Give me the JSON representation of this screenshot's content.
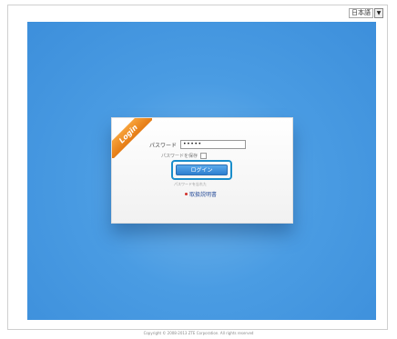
{
  "language": {
    "selected": "日本語",
    "dropdown_icon": "chevron-down-icon"
  },
  "login_card": {
    "ribbon_text": "Login",
    "password_label": "パスワード",
    "password_value": "•••••",
    "remember_label": "パスワードを保存",
    "login_button": "ログイン",
    "forgot_text": "パスワードを忘れた",
    "manual_link": "取扱説明書"
  },
  "footer": {
    "copyright": "Copyright © 2008-2013 ZTE Corporation. All rights reserved"
  },
  "colors": {
    "panel_blue": "#4a9ce3",
    "ribbon_orange": "#f09020",
    "button_blue": "#3a8fde",
    "highlight_outline": "#1a8ecb"
  }
}
